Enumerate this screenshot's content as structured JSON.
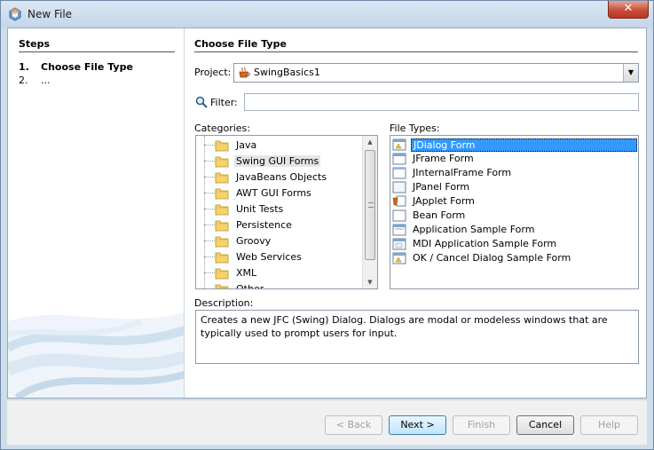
{
  "window": {
    "title": "New File",
    "close_glyph": "✕"
  },
  "steps": {
    "title": "Steps",
    "items": [
      {
        "num": "1.",
        "label": "Choose File Type"
      },
      {
        "num": "2.",
        "label": "..."
      }
    ]
  },
  "main": {
    "title": "Choose File Type",
    "project_label": "Project:",
    "project_value": "SwingBasics1",
    "filter_label": "Filter:",
    "filter_value": "",
    "categories_label": "Categories:",
    "file_types_label": "File Types:",
    "description_label": "Description:"
  },
  "categories": [
    {
      "label": "Java"
    },
    {
      "label": "Swing GUI Forms"
    },
    {
      "label": "JavaBeans Objects"
    },
    {
      "label": "AWT GUI Forms"
    },
    {
      "label": "Unit Tests"
    },
    {
      "label": "Persistence"
    },
    {
      "label": "Groovy"
    },
    {
      "label": "Web Services"
    },
    {
      "label": "XML"
    },
    {
      "label": "Other"
    }
  ],
  "selected_category": "Swing GUI Forms",
  "file_types": [
    {
      "label": "JDialog Form",
      "icon": "dialog-form-icon"
    },
    {
      "label": "JFrame Form",
      "icon": "frame-form-icon"
    },
    {
      "label": "JInternalFrame Form",
      "icon": "internal-frame-icon"
    },
    {
      "label": "JPanel Form",
      "icon": "panel-form-icon"
    },
    {
      "label": "JApplet Form",
      "icon": "applet-form-icon"
    },
    {
      "label": "Bean Form",
      "icon": "bean-form-icon"
    },
    {
      "label": "Application Sample Form",
      "icon": "application-form-icon"
    },
    {
      "label": "MDI Application Sample Form",
      "icon": "mdi-form-icon"
    },
    {
      "label": "OK / Cancel Dialog Sample Form",
      "icon": "ok-cancel-dialog-icon"
    }
  ],
  "selected_file_type": "JDialog Form",
  "description": "Creates a new JFC (Swing) Dialog. Dialogs are modal or modeless windows that are typically used to prompt users for input.",
  "buttons": {
    "back": "< Back",
    "next": "Next >",
    "finish": "Finish",
    "cancel": "Cancel",
    "help": "Help"
  }
}
